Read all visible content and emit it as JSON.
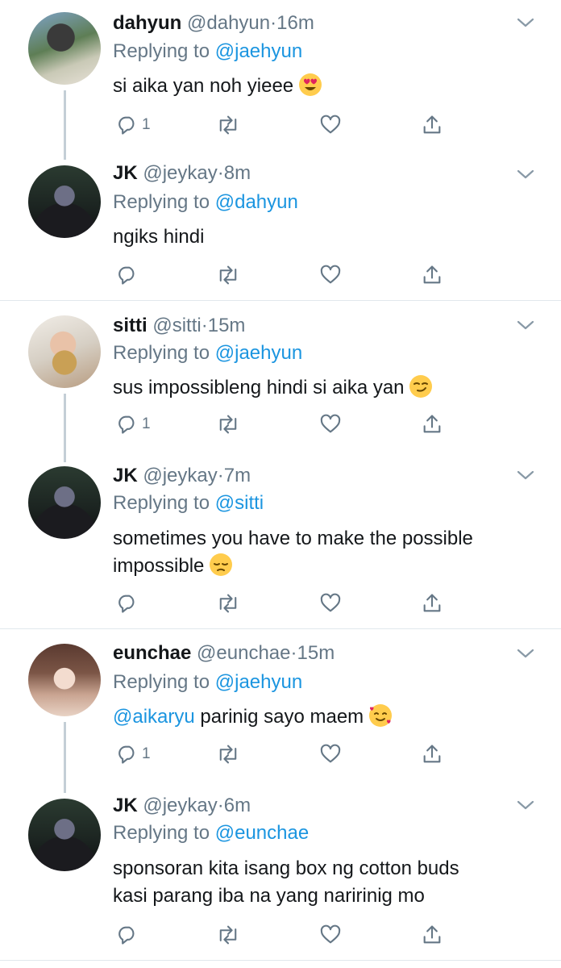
{
  "colors": {
    "link": "#1b95e0",
    "secondary": "#657786",
    "divider": "#e1e8ed",
    "thread_line": "#c4cfd6"
  },
  "replying_label": "Replying to",
  "tweets": [
    {
      "name": "dahyun",
      "handle": "@dahyun",
      "sep": "·",
      "time": "16m",
      "replying_to": "@jaehyun",
      "text": "si aika yan noh yieee",
      "emoji": "heart-eyes-emoji",
      "reply_count": "1"
    },
    {
      "name": "JK",
      "handle": "@jeykay",
      "sep": "·",
      "time": "8m",
      "replying_to": "@dahyun",
      "text": "ngiks hindi"
    },
    {
      "name": "sitti",
      "handle": "@sitti",
      "sep": "·",
      "time": "15m",
      "replying_to": "@jaehyun",
      "text": "sus impossibleng hindi si aika yan",
      "emoji": "smirk-emoji",
      "reply_count": "1"
    },
    {
      "name": "JK",
      "handle": "@jeykay",
      "sep": "·",
      "time": "7m",
      "replying_to": "@sitti",
      "text_line1": "sometimes you have to make the possible",
      "text_line2": "impossible",
      "emoji": "pensive-emoji"
    },
    {
      "name": "eunchae",
      "handle": "@eunchae",
      "sep": "·",
      "time": "15m",
      "replying_to": "@jaehyun",
      "mention": "@aikaryu",
      "text": " parinig sayo maem",
      "emoji": "smiling-hearts-emoji",
      "reply_count": "1"
    },
    {
      "name": "JK",
      "handle": "@jeykay",
      "sep": "·",
      "time": "6m",
      "replying_to": "@eunchae",
      "text_line1": "sponsoran kita isang box ng cotton buds",
      "text_line2": "kasi parang iba na yang naririnig mo"
    }
  ]
}
